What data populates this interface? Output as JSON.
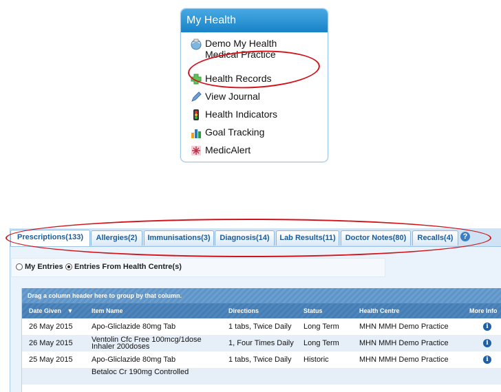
{
  "my_health": {
    "title": "My Health",
    "items": [
      {
        "label": "Demo My Health Medical Practice",
        "icon": "globe-icon"
      },
      {
        "label": "Health Records",
        "icon": "green-plus-icon"
      },
      {
        "label": "View Journal",
        "icon": "pencil-icon"
      },
      {
        "label": "Health Indicators",
        "icon": "traffic-light-icon"
      },
      {
        "label": "Goal Tracking",
        "icon": "bar-chart-icon"
      },
      {
        "label": "MedicAlert",
        "icon": "medic-alert-icon"
      }
    ]
  },
  "tabs": [
    {
      "label": "Prescriptions(133)",
      "active": true
    },
    {
      "label": "Allergies(2)"
    },
    {
      "label": "Immunisations(3)"
    },
    {
      "label": "Diagnosis(14)"
    },
    {
      "label": "Lab Results(11)"
    },
    {
      "label": "Doctor Notes(80)"
    },
    {
      "label": "Recalls(4)"
    }
  ],
  "help_glyph": "?",
  "filter": {
    "options": [
      {
        "label": "My Entries",
        "selected": false
      },
      {
        "label": "Entries From Health Centre(s)",
        "selected": true
      }
    ]
  },
  "grid": {
    "group_hint": "Drag a column header here to group by that column.",
    "columns": [
      "Date Given",
      "Item Name",
      "Directions",
      "Status",
      "Health Centre",
      "More Info"
    ],
    "sort_indicator": "▼",
    "rows": [
      {
        "date": "26 May 2015",
        "item": "Apo-Gliclazide 80mg Tab",
        "directions": "1 tabs, Twice Daily",
        "status": "Long Term",
        "centre": "MHN MMH Demo Practice"
      },
      {
        "date": "26 May 2015",
        "item": "Ventolin Cfc Free 100mcg/1dose Inhaler 200doses",
        "directions": "1, Four Times Daily",
        "status": "Long Term",
        "centre": "MHN MMH Demo Practice"
      },
      {
        "date": "25 May 2015",
        "item": "Apo-Gliclazide 80mg Tab",
        "directions": "1 tabs, Twice Daily",
        "status": "Historic",
        "centre": "MHN MMH Demo Practice"
      },
      {
        "date": "",
        "item": "Betaloc Cr 190mg Controlled",
        "directions": "",
        "status": "",
        "centre": ""
      }
    ]
  },
  "colors": {
    "highlight": "#d1141b",
    "header_blue": "#1883c8"
  }
}
